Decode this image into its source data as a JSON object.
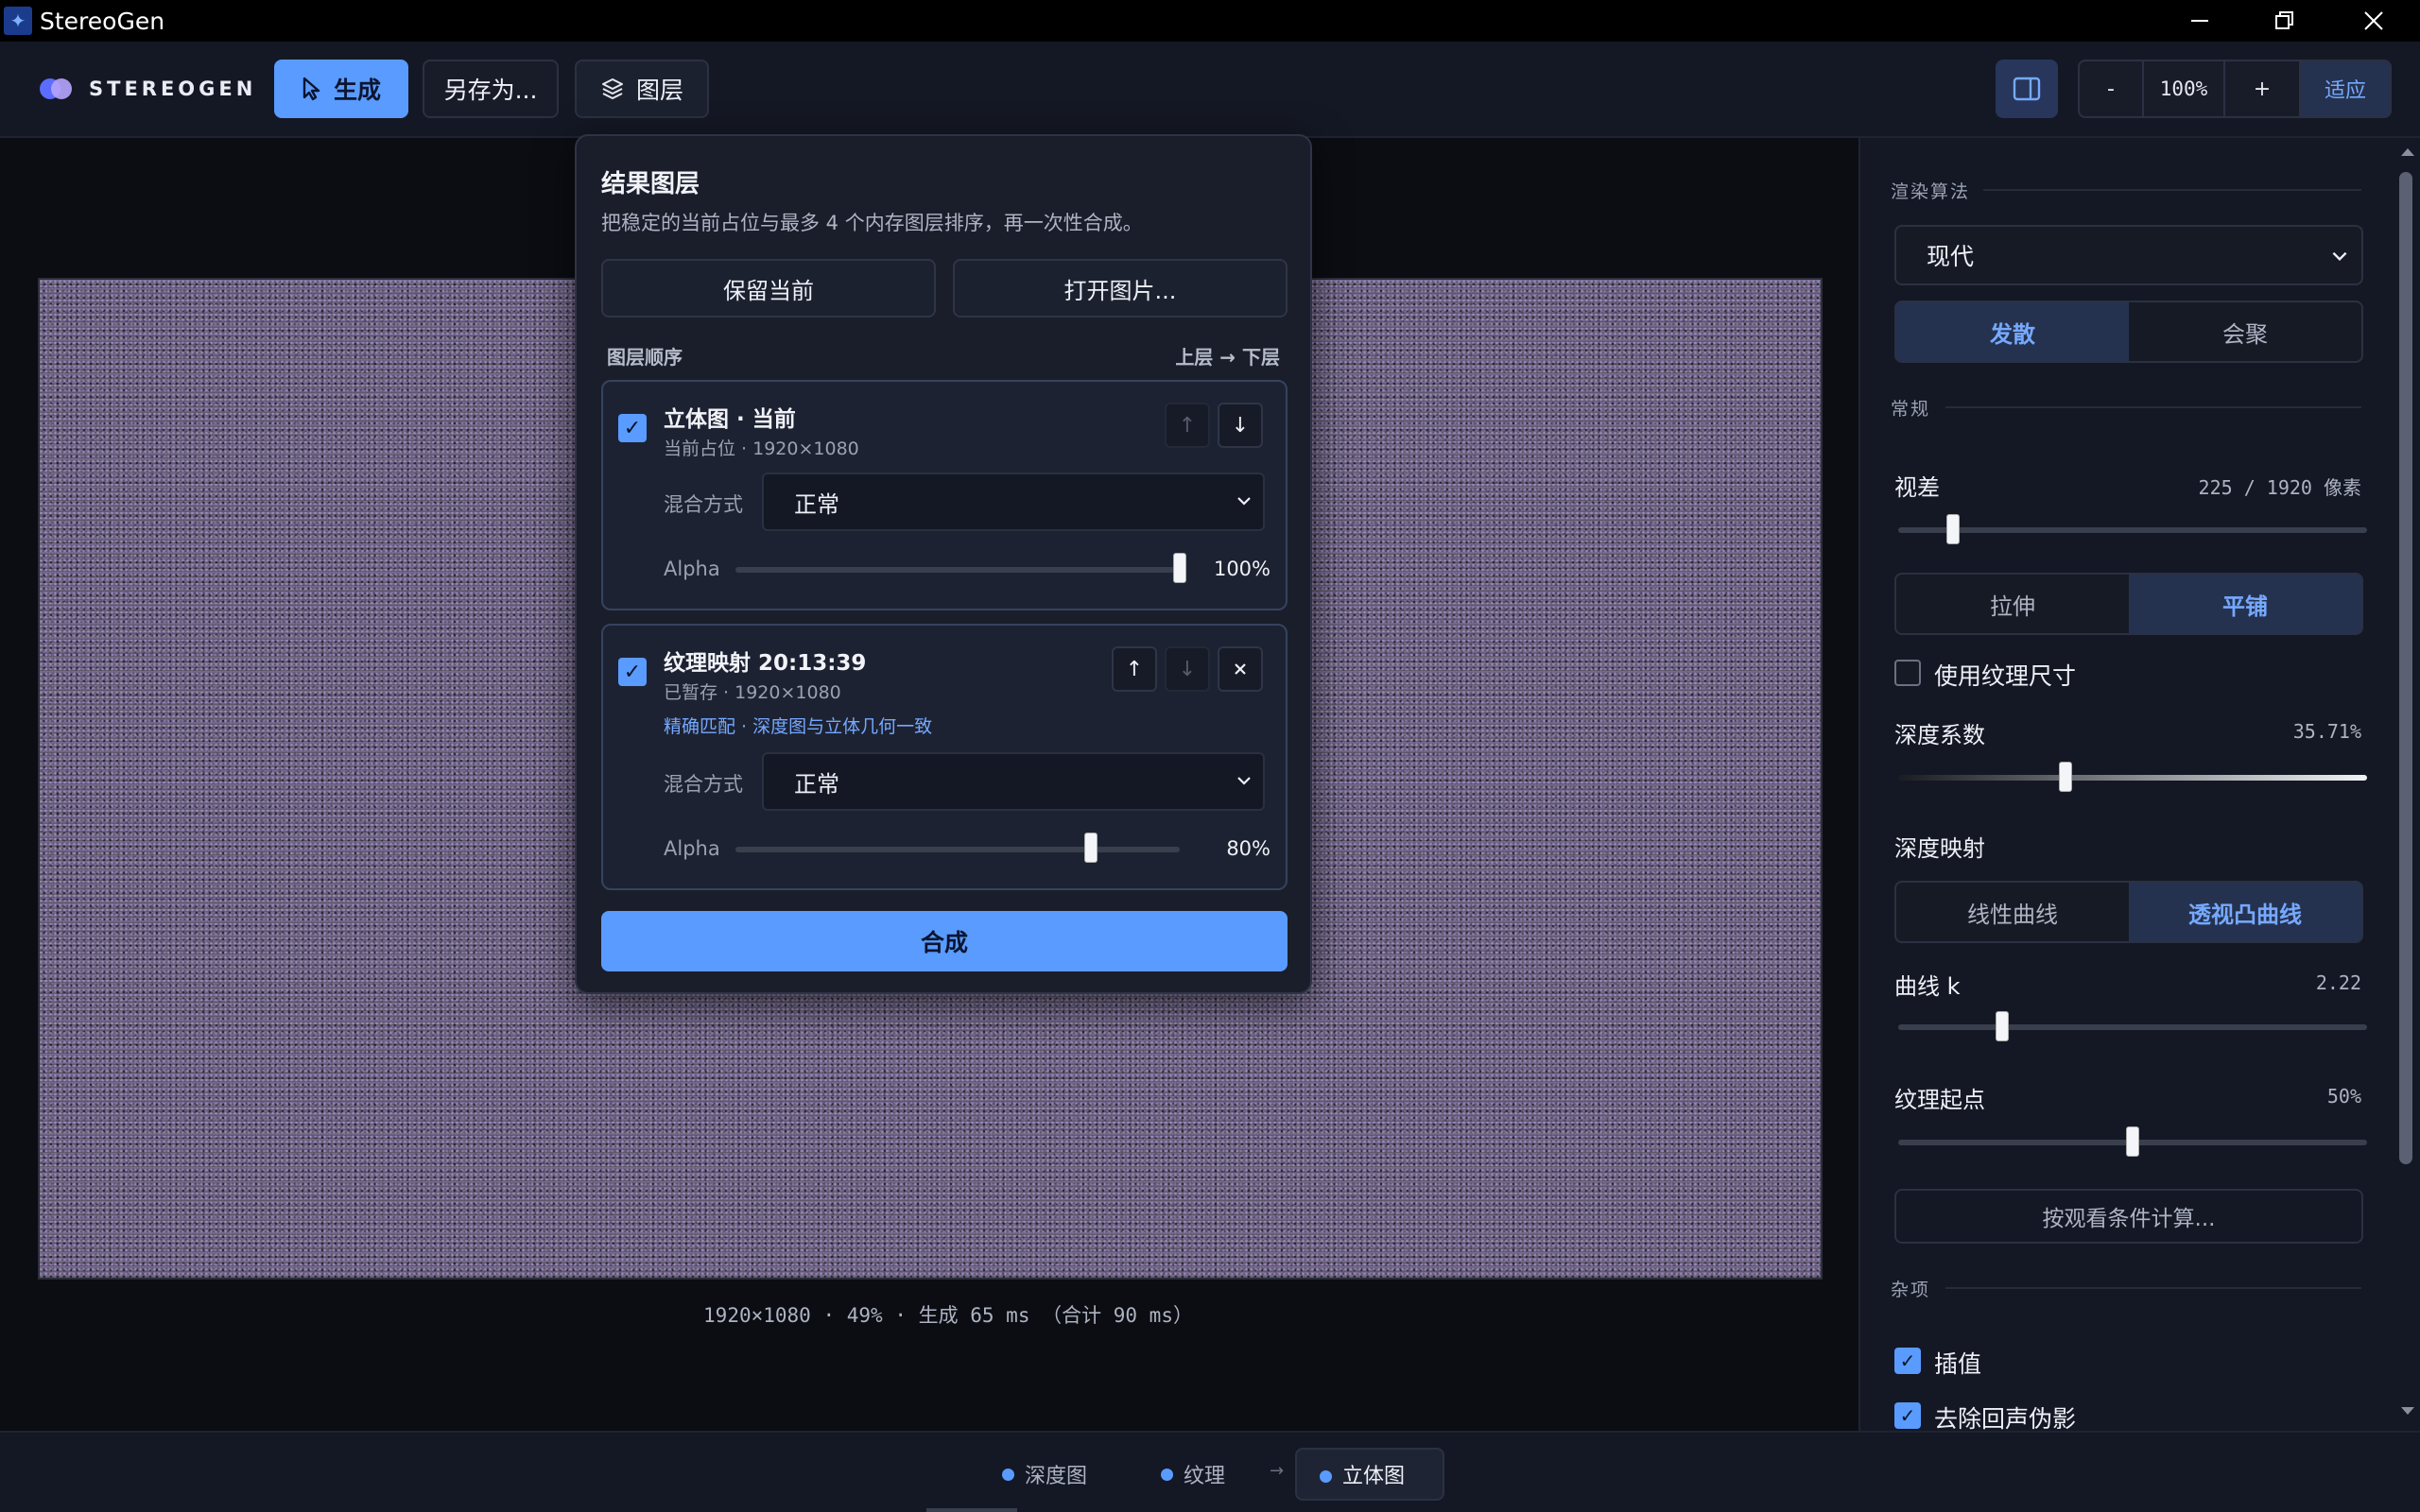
{
  "window": {
    "title": "StereoGen"
  },
  "toolbar": {
    "brand": "STEREOGEN",
    "generate_label": "生成",
    "save_as_label": "另存为...",
    "layers_label": "图层",
    "zoom_minus": "-",
    "zoom_value": "100%",
    "zoom_plus": "+",
    "fit_label": "适应"
  },
  "canvas": {
    "status": "1920×1080 · 49% · 生成 65 ms （合计 90 ms）"
  },
  "popover": {
    "title": "结果图层",
    "description": "把稳定的当前占位与最多 4 个内存图层排序，再一次性合成。",
    "keep_current_label": "保留当前",
    "open_image_label": "打开图片...",
    "order_label": "图层顺序",
    "order_hint": "上层 → 下层",
    "layers": [
      {
        "name": "立体图 · 当前",
        "sub": "当前占位 · 1920×1080",
        "blend_label": "混合方式",
        "blend_value": "正常",
        "alpha_label": "Alpha",
        "alpha_text": "100%",
        "alpha": 1.0
      },
      {
        "name": "纹理映射 20:13:39",
        "sub": "已暂存 · 1920×1080",
        "link": "精确匹配 · 深度图与立体几何一致",
        "blend_label": "混合方式",
        "blend_value": "正常",
        "alpha_label": "Alpha",
        "alpha_text": "80%",
        "alpha": 0.8
      }
    ],
    "compose_label": "合成"
  },
  "sidebar": {
    "render_title": "渲染算法",
    "algorithm": "现代",
    "mode_options": [
      "发散",
      "会聚"
    ],
    "mode_selected": "发散",
    "general_title": "常规",
    "parallax_label": "视差",
    "parallax_value": "225 / 1920 像素",
    "parallax_fraction": 0.117,
    "fill_options": [
      "拉伸",
      "平铺"
    ],
    "fill_selected": "平铺",
    "use_texture_size_label": "使用纹理尺寸",
    "use_texture_size": false,
    "depth_factor_label": "深度系数",
    "depth_factor_value": "35.71%",
    "depth_factor_fraction": 0.3571,
    "depth_map_label": "深度映射",
    "curve_options": [
      "线性曲线",
      "透视凸曲线"
    ],
    "curve_selected": "透视凸曲线",
    "curve_k_label": "曲线 k",
    "curve_k_value": "2.22",
    "curve_k_fraction": 0.222,
    "texture_origin_label": "纹理起点",
    "texture_origin_value": "50%",
    "texture_origin_fraction": 0.5,
    "compute_button": "按观看条件计算...",
    "misc_title": "杂项",
    "interpolate_label": "插值",
    "interpolate": true,
    "remove_echo_label": "去除回声伪影",
    "remove_echo": true
  },
  "bottom": {
    "tabs": [
      "深度图",
      "纹理",
      "立体图"
    ],
    "active": "立体图",
    "arrow": "→"
  },
  "colors": {
    "accent": "#5a9bff",
    "panel": "#141824",
    "background": "#0d0f16"
  }
}
